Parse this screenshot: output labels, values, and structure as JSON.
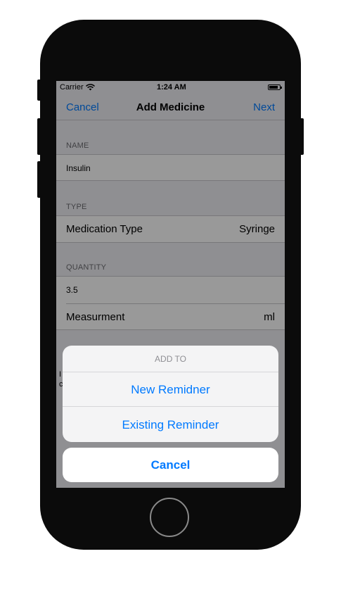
{
  "status_bar": {
    "carrier": "Carrier",
    "time": "1:24 AM"
  },
  "nav": {
    "cancel_label": "Cancel",
    "title": "Add Medicine",
    "next_label": "Next"
  },
  "sections": {
    "name": {
      "header": "NAME",
      "value": "Insulin"
    },
    "type": {
      "header": "TYPE",
      "label": "Medication Type",
      "value": "Syringe"
    },
    "quantity": {
      "header": "QUANTITY",
      "value": "3.5",
      "measurement_label": "Measurment",
      "measurement_value": "ml"
    }
  },
  "footer_partial": {
    "line1": "I",
    "line2": "c"
  },
  "action_sheet": {
    "title": "ADD TO",
    "actions": [
      {
        "label": "New Remidner"
      },
      {
        "label": "Existing Reminder"
      }
    ],
    "cancel_label": "Cancel"
  },
  "colors": {
    "accent": "#007aff",
    "background": "#efeff4",
    "phone": "#0b0b0b"
  }
}
